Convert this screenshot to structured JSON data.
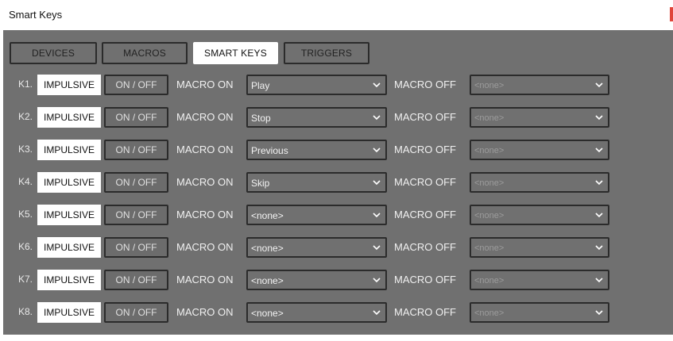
{
  "window": {
    "title": "Smart Keys"
  },
  "tabs": [
    {
      "label": "DEVICES",
      "active": false
    },
    {
      "label": "MACROS",
      "active": false
    },
    {
      "label": "SMART KEYS",
      "active": true
    },
    {
      "label": "TRIGGERS",
      "active": false
    }
  ],
  "row_labels": {
    "mode": "IMPULSIVE",
    "toggle": "ON / OFF",
    "macro_on": "MACRO ON",
    "macro_off": "MACRO OFF"
  },
  "keys": [
    {
      "id": "K1.",
      "macro_on_value": "Play",
      "macro_off_value": "<none>"
    },
    {
      "id": "K2.",
      "macro_on_value": "Stop",
      "macro_off_value": "<none>"
    },
    {
      "id": "K3.",
      "macro_on_value": "Previous",
      "macro_off_value": "<none>"
    },
    {
      "id": "K4.",
      "macro_on_value": "Skip",
      "macro_off_value": "<none>"
    },
    {
      "id": "K5.",
      "macro_on_value": "<none>",
      "macro_off_value": "<none>"
    },
    {
      "id": "K6.",
      "macro_on_value": "<none>",
      "macro_off_value": "<none>"
    },
    {
      "id": "K7.",
      "macro_on_value": "<none>",
      "macro_off_value": "<none>"
    },
    {
      "id": "K8.",
      "macro_on_value": "<none>",
      "macro_off_value": "<none>"
    }
  ],
  "icons": {
    "dropdown": "chevron-down-icon",
    "window_close": "close-icon"
  },
  "colors": {
    "panel_bg": "#707070",
    "border": "#2b2b2b",
    "active_tab": "#ffffff",
    "close_red": "#e0453a"
  }
}
